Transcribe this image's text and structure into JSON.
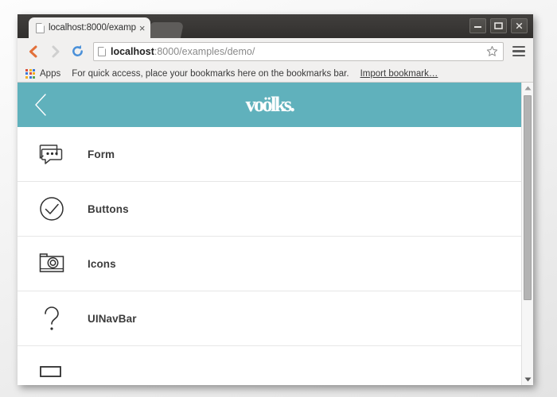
{
  "browser": {
    "tab": {
      "title": "localhost:8000/examp",
      "close_label": "×",
      "favicon": "document-icon"
    },
    "window_controls": {
      "minimize": "minimize-icon",
      "maximize": "maximize-icon",
      "close": "close-icon"
    },
    "toolbar": {
      "back": "back-arrow-icon",
      "forward": "forward-arrow-icon",
      "reload": "reload-icon",
      "star": "star-icon",
      "menu": "hamburger-menu-icon",
      "url_host": "localhost",
      "url_rest": ":8000/examples/demo/",
      "url_full": "localhost:8000/examples/demo/"
    },
    "bookmarks_bar": {
      "apps_label": "Apps",
      "hint": "For quick access, place your bookmarks here on the bookmarks bar.",
      "import_label": "Import bookmark…",
      "apps_colors": [
        "#d94f3d",
        "#f2b01e",
        "#3c78d8",
        "#3c78d8",
        "#d94f3d",
        "#f2b01e",
        "#f2b01e",
        "#3c78d8",
        "#5aa454"
      ]
    }
  },
  "page": {
    "navbar": {
      "back_icon": "chevron-left-icon",
      "brand": "voölks."
    },
    "colors": {
      "navbar_teal": "#60b1bc",
      "divider": "#e6e6e6",
      "text": "#3c3c3c"
    },
    "list": [
      {
        "label": "Form",
        "icon": "speech-bubble-dots-icon"
      },
      {
        "label": "Buttons",
        "icon": "check-circle-icon"
      },
      {
        "label": "Icons",
        "icon": "camera-icon"
      },
      {
        "label": "UINavBar",
        "icon": "question-mark-icon"
      },
      {
        "label": "",
        "icon": "rectangle-icon"
      }
    ],
    "scrollbar": {
      "up": "scroll-up-arrow-icon",
      "down": "scroll-down-arrow-icon",
      "thumb": "scrollbar-thumb"
    }
  }
}
